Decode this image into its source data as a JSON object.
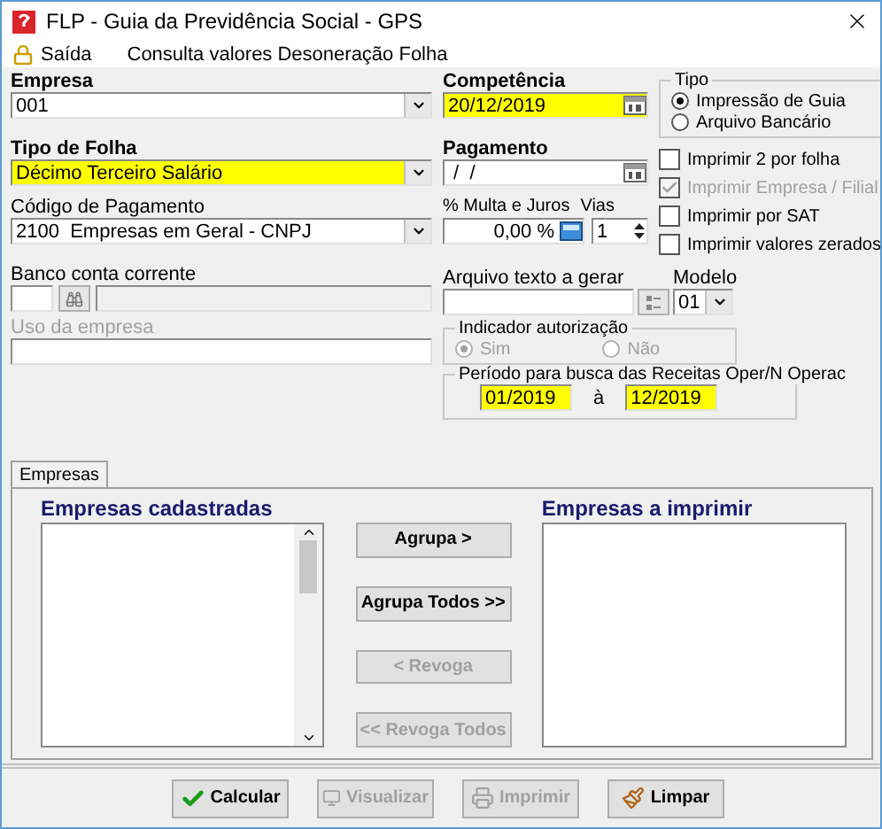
{
  "window": {
    "title": "FLP - Guia da Previdência Social - GPS"
  },
  "menu": [
    {
      "label": "Saída",
      "kind": "lock"
    },
    {
      "label": "Consulta valores Desoneração Folha",
      "kind": "plain"
    }
  ],
  "empresa": {
    "label": "Empresa",
    "value": "001",
    "highlighted": false
  },
  "tipo_folha": {
    "label": "Tipo de Folha",
    "value": "Décimo Terceiro Salário",
    "highlighted": true
  },
  "codigo_pagamento": {
    "label": "Código de Pagamento",
    "value": "2100  Empresas em Geral - CNPJ"
  },
  "banco_conta_corrente": {
    "label": "Banco conta corrente"
  },
  "uso_empresa": {
    "label": "Uso da empresa",
    "disabled": true
  },
  "competencia": {
    "label": "Competência",
    "value": "20/12/2019",
    "highlighted": true
  },
  "pagamento": {
    "label": "Pagamento",
    "value": " /  /",
    "highlighted": false
  },
  "multa_juros": {
    "label": "% Multa e Juros",
    "value": "0,00 %"
  },
  "vias": {
    "label": "Vias",
    "value": "1"
  },
  "tipo": {
    "label": "Tipo",
    "options": [
      {
        "label": "Impressão de Guia",
        "selected": true
      },
      {
        "label": "Arquivo Bancário",
        "selected": false
      }
    ]
  },
  "print_options": [
    {
      "label": "Imprimir 2 por folha",
      "checked": false,
      "disabled": false
    },
    {
      "label": "Imprimir Empresa / Filial",
      "checked": true,
      "disabled": true
    },
    {
      "label": "Imprimir por SAT",
      "checked": false,
      "disabled": false
    },
    {
      "label": "Imprimir valores zerados",
      "checked": false,
      "disabled": false
    }
  ],
  "arquivo_texto": {
    "label": "Arquivo texto a gerar"
  },
  "modelo": {
    "label": "Modelo",
    "value": "01"
  },
  "indicador_autorizacao": {
    "label": "Indicador autorização",
    "disabled": true,
    "options": [
      {
        "label": "Sim",
        "selected": true
      },
      {
        "label": "Não",
        "selected": false
      }
    ]
  },
  "periodo": {
    "label": "Período para busca das Receitas Oper/N Operac",
    "from": "01/2019",
    "separator": "à",
    "to": "12/2019"
  },
  "tabs": [
    {
      "label": "Empresas",
      "selected": true
    }
  ],
  "empresas_cadastradas": {
    "title": "Empresas cadastradas"
  },
  "empresas_imprimir": {
    "title": "Empresas a imprimir"
  },
  "transfer_buttons": [
    {
      "label": "Agrupa >",
      "disabled": false
    },
    {
      "label": "Agrupa Todos >>",
      "disabled": false
    },
    {
      "label": "< Revoga",
      "disabled": true
    },
    {
      "label": "<< Revoga Todos",
      "disabled": true
    }
  ],
  "footer_buttons": [
    {
      "label": "Calcular",
      "kind": "check",
      "disabled": false
    },
    {
      "label": "Visualizar",
      "kind": "monitor",
      "disabled": true
    },
    {
      "label": "Imprimir",
      "kind": "printer",
      "disabled": true
    },
    {
      "label": "Limpar",
      "kind": "brush",
      "disabled": false
    }
  ]
}
